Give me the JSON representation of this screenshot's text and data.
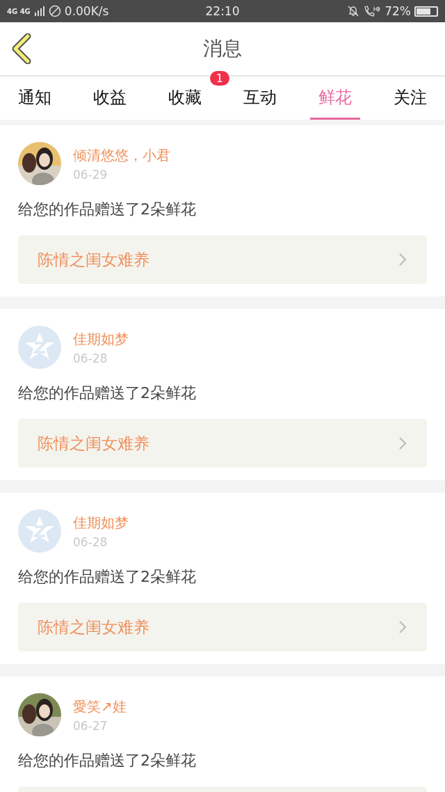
{
  "status_bar": {
    "network": "4G 4G",
    "speed": "0.00K/s",
    "time": "22:10",
    "battery": "72%"
  },
  "header": {
    "title": "消息"
  },
  "tabs": [
    {
      "label": "通知",
      "selected": false
    },
    {
      "label": "收益",
      "selected": false
    },
    {
      "label": "收藏",
      "selected": false,
      "badge": "1"
    },
    {
      "label": "互动",
      "selected": false
    },
    {
      "label": "鲜花",
      "selected": true
    },
    {
      "label": "关注",
      "selected": false
    }
  ],
  "messages": [
    {
      "name": "倾清悠悠，小君",
      "date": "06-29",
      "text": "给您的作品赠送了2朵鲜花",
      "link": "陈情之闺女难养"
    },
    {
      "kind": "default",
      "name": "佳期如梦",
      "date": "06-28",
      "text": "给您的作品赠送了2朵鲜花",
      "link": "陈情之闺女难养"
    },
    {
      "kind": "default",
      "name": "佳期如梦",
      "date": "06-28",
      "text": "给您的作品赠送了2朵鲜花",
      "link": "陈情之闺女难养"
    },
    {
      "name": "愛笑↗娃",
      "date": "06-27",
      "text": "给您的作品赠送了2朵鲜花"
    }
  ]
}
